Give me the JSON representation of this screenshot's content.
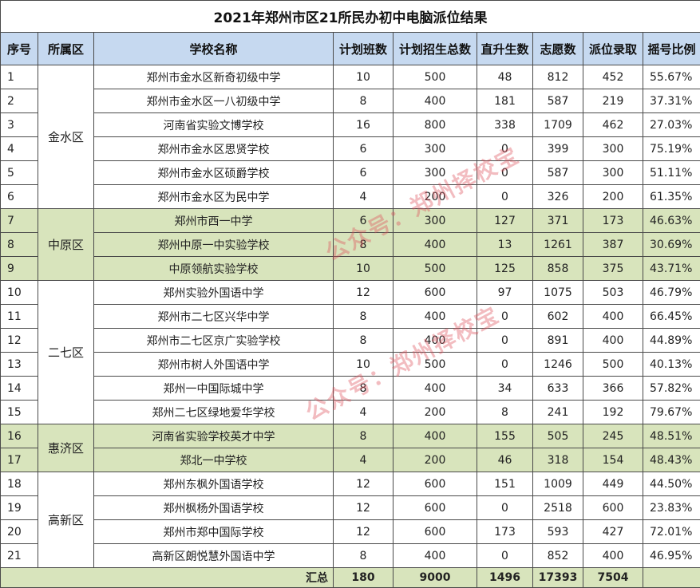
{
  "title": "2021年郑州市区21所民办初中电脑派位结果",
  "headers": [
    "序号",
    "所属区",
    "学校名称",
    "计划班数",
    "计划招生总数",
    "直升生数",
    "志愿数",
    "派位录取",
    "摇号比例"
  ],
  "districts": [
    {
      "name": "金水区",
      "rows": 6,
      "green": false
    },
    {
      "name": "中原区",
      "rows": 3,
      "green": true
    },
    {
      "name": "二七区",
      "rows": 6,
      "green": false
    },
    {
      "name": "惠济区",
      "rows": 2,
      "green": true
    },
    {
      "name": "高新区",
      "rows": 4,
      "green": false
    }
  ],
  "rows": [
    [
      "1",
      "郑州市金水区新奇初级中学",
      "10",
      "500",
      "48",
      "812",
      "452",
      "55.67%"
    ],
    [
      "2",
      "郑州市金水区一八初级中学",
      "8",
      "400",
      "181",
      "587",
      "219",
      "37.31%"
    ],
    [
      "3",
      "河南省实验文博学校",
      "16",
      "800",
      "338",
      "1709",
      "462",
      "27.03%"
    ],
    [
      "4",
      "郑州市金水区思贤学校",
      "6",
      "300",
      "0",
      "399",
      "300",
      "75.19%"
    ],
    [
      "5",
      "郑州市金水区硕爵学校",
      "6",
      "300",
      "0",
      "587",
      "300",
      "51.11%"
    ],
    [
      "6",
      "郑州市金水区为民中学",
      "4",
      "200",
      "0",
      "326",
      "200",
      "61.35%"
    ],
    [
      "7",
      "郑州市西一中学",
      "6",
      "300",
      "127",
      "371",
      "173",
      "46.63%"
    ],
    [
      "8",
      "郑州中原一中实验学校",
      "8",
      "400",
      "13",
      "1261",
      "387",
      "30.69%"
    ],
    [
      "9",
      "中原领航实验学校",
      "10",
      "500",
      "125",
      "858",
      "375",
      "43.71%"
    ],
    [
      "10",
      "郑州实验外国语中学",
      "12",
      "600",
      "97",
      "1075",
      "503",
      "46.79%"
    ],
    [
      "11",
      "郑州市二七区兴华中学",
      "8",
      "400",
      "0",
      "602",
      "400",
      "66.45%"
    ],
    [
      "12",
      "郑州市二七区京广实验学校",
      "8",
      "400",
      "0",
      "891",
      "400",
      "44.89%"
    ],
    [
      "13",
      "郑州市树人外国语中学",
      "10",
      "500",
      "0",
      "1246",
      "500",
      "40.13%"
    ],
    [
      "14",
      "郑州一中国际城中学",
      "8",
      "400",
      "34",
      "633",
      "366",
      "57.82%"
    ],
    [
      "15",
      "郑州二七区绿地爱华学校",
      "4",
      "200",
      "8",
      "241",
      "192",
      "79.67%"
    ],
    [
      "16",
      "河南省实验学校英才中学",
      "8",
      "400",
      "155",
      "505",
      "245",
      "48.51%"
    ],
    [
      "17",
      "郑北一中学校",
      "4",
      "200",
      "46",
      "318",
      "154",
      "48.43%"
    ],
    [
      "18",
      "郑州东枫外国语学校",
      "12",
      "600",
      "151",
      "1009",
      "449",
      "44.50%"
    ],
    [
      "19",
      "郑州枫杨外国语学校",
      "12",
      "600",
      "0",
      "2518",
      "600",
      "23.83%"
    ],
    [
      "20",
      "郑州市郑中国际学校",
      "12",
      "600",
      "173",
      "593",
      "427",
      "72.01%"
    ],
    [
      "21",
      "高新区朗悦慧外国语中学",
      "8",
      "400",
      "0",
      "852",
      "400",
      "46.95%"
    ]
  ],
  "totals": {
    "label": "汇总",
    "classes": "180",
    "enroll": "9000",
    "direct": "1496",
    "applicants": "17393",
    "admitted": "7504"
  },
  "watermarks": [
    "公众号：郑州择校宝",
    "公众号：郑州择校宝"
  ]
}
